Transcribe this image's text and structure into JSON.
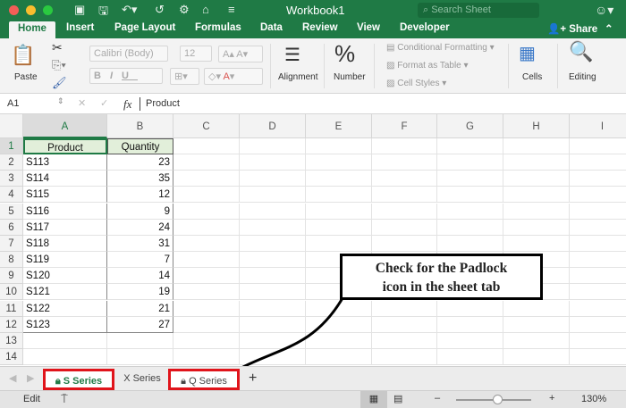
{
  "window": {
    "title": "Workbook1",
    "search_placeholder": "Search Sheet"
  },
  "tabs": [
    "Home",
    "Insert",
    "Page Layout",
    "Formulas",
    "Data",
    "Review",
    "View",
    "Developer"
  ],
  "share_label": "Share",
  "ribbon": {
    "paste": "Paste",
    "font_name": "Calibri (Body)",
    "font_size": "12",
    "bold": "B",
    "italic": "I",
    "underline": "U",
    "alignment": "Alignment",
    "number": "Number",
    "conditional_formatting": "Conditional Formatting",
    "format_as_table": "Format as Table",
    "cell_styles": "Cell Styles",
    "cells": "Cells",
    "editing": "Editing"
  },
  "formula_bar": {
    "name_box": "A1",
    "fx": "fx",
    "content": "Product"
  },
  "columns": [
    "A",
    "B",
    "C",
    "D",
    "E",
    "F",
    "G",
    "H",
    "I"
  ],
  "rows": [
    "1",
    "2",
    "3",
    "4",
    "5",
    "6",
    "7",
    "8",
    "9",
    "10",
    "11",
    "12",
    "13",
    "14"
  ],
  "table": {
    "headers": [
      "Product",
      "Quantity"
    ],
    "data": [
      [
        "S113",
        "23"
      ],
      [
        "S114",
        "35"
      ],
      [
        "S115",
        "12"
      ],
      [
        "S116",
        "9"
      ],
      [
        "S117",
        "24"
      ],
      [
        "S118",
        "31"
      ],
      [
        "S119",
        "7"
      ],
      [
        "S120",
        "14"
      ],
      [
        "S121",
        "19"
      ],
      [
        "S122",
        "21"
      ],
      [
        "S123",
        "27"
      ]
    ]
  },
  "sheets": [
    {
      "name": "S Series",
      "locked": true,
      "active": true
    },
    {
      "name": "X Series",
      "locked": false,
      "active": false
    },
    {
      "name": "Q Series",
      "locked": true,
      "active": false
    }
  ],
  "add_sheet": "+",
  "status": {
    "mode": "Edit",
    "zoom": "130%",
    "zoom_minus": "–",
    "zoom_plus": "+",
    "zoom_fraction": 0.55
  },
  "callout": {
    "line1": "Check for the Padlock",
    "line2": "icon in the sheet tab"
  },
  "colors": {
    "brand": "#1f7a45",
    "highlight": "#e0141b",
    "header_fill": "#e2efda"
  }
}
